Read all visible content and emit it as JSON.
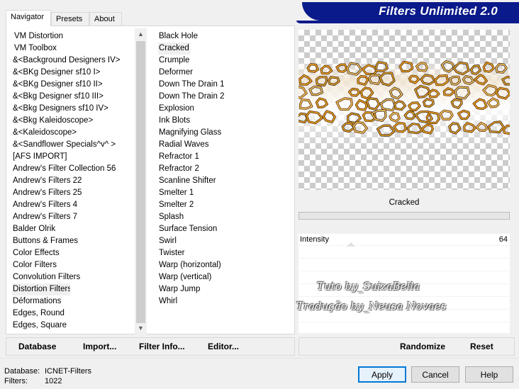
{
  "banner_title": "Filters Unlimited 2.0",
  "tabs": [
    "Navigator",
    "Presets",
    "About"
  ],
  "categories": [
    "VM Distortion",
    "VM Toolbox",
    "&<Background Designers IV>",
    "&<BKg Designer sf10 I>",
    "&<BKg Designer sf10 II>",
    "&<Bkg Designer sf10 III>",
    "&<Bkg Designers sf10 IV>",
    "&<Bkg Kaleidoscope>",
    "&<Kaleidoscope>",
    "&<Sandflower Specials^v^ >",
    "[AFS IMPORT]",
    "Andrew's Filter Collection 56",
    "Andrew's Filters 22",
    "Andrew's Filters 25",
    "Andrew's Filters 4",
    "Andrew's Filters 7",
    "Balder Olrik",
    "Buttons & Frames",
    "Color Effects",
    "Color Filters",
    "Convolution Filters",
    "Distortion Filters",
    "Déformations",
    "Edges, Round",
    "Edges, Square"
  ],
  "selected_category": "Distortion Filters",
  "filters": [
    "Black Hole",
    "Cracked",
    "Crumple",
    "Deformer",
    "Down The Drain 1",
    "Down The Drain 2",
    "Explosion",
    "Ink Blots",
    "Magnifying Glass",
    "Radial Waves",
    "Refractor 1",
    "Refractor 2",
    "Scanline Shifter",
    "Smelter 1",
    "Smelter 2",
    "Splash",
    "Surface Tension",
    "Swirl",
    "Twister",
    "Warp (horizontal)",
    "Warp (vertical)",
    "Warp Jump",
    "Whirl"
  ],
  "selected_filter": "Cracked",
  "left_toolbar": {
    "database": "Database",
    "import": "Import...",
    "filter_info": "Filter Info...",
    "editor": "Editor..."
  },
  "filter_name": "Cracked",
  "parameter": {
    "label": "Intensity",
    "value": "64"
  },
  "watermark": {
    "line1": "Tuto by_SuizaBella",
    "line2": "Tradução by_Neusa Novaes"
  },
  "right_toolbar": {
    "randomize": "Randomize",
    "reset": "Reset"
  },
  "footer": {
    "database_label": "Database:",
    "database_value": "ICNET-Filters",
    "filters_label": "Filters:",
    "filters_value": "1022"
  },
  "buttons": {
    "apply": "Apply",
    "cancel": "Cancel",
    "help": "Help"
  },
  "colors": {
    "banner": "#0a1a8a",
    "cracks": "#e8a020",
    "apply_border": "#0078d7"
  }
}
